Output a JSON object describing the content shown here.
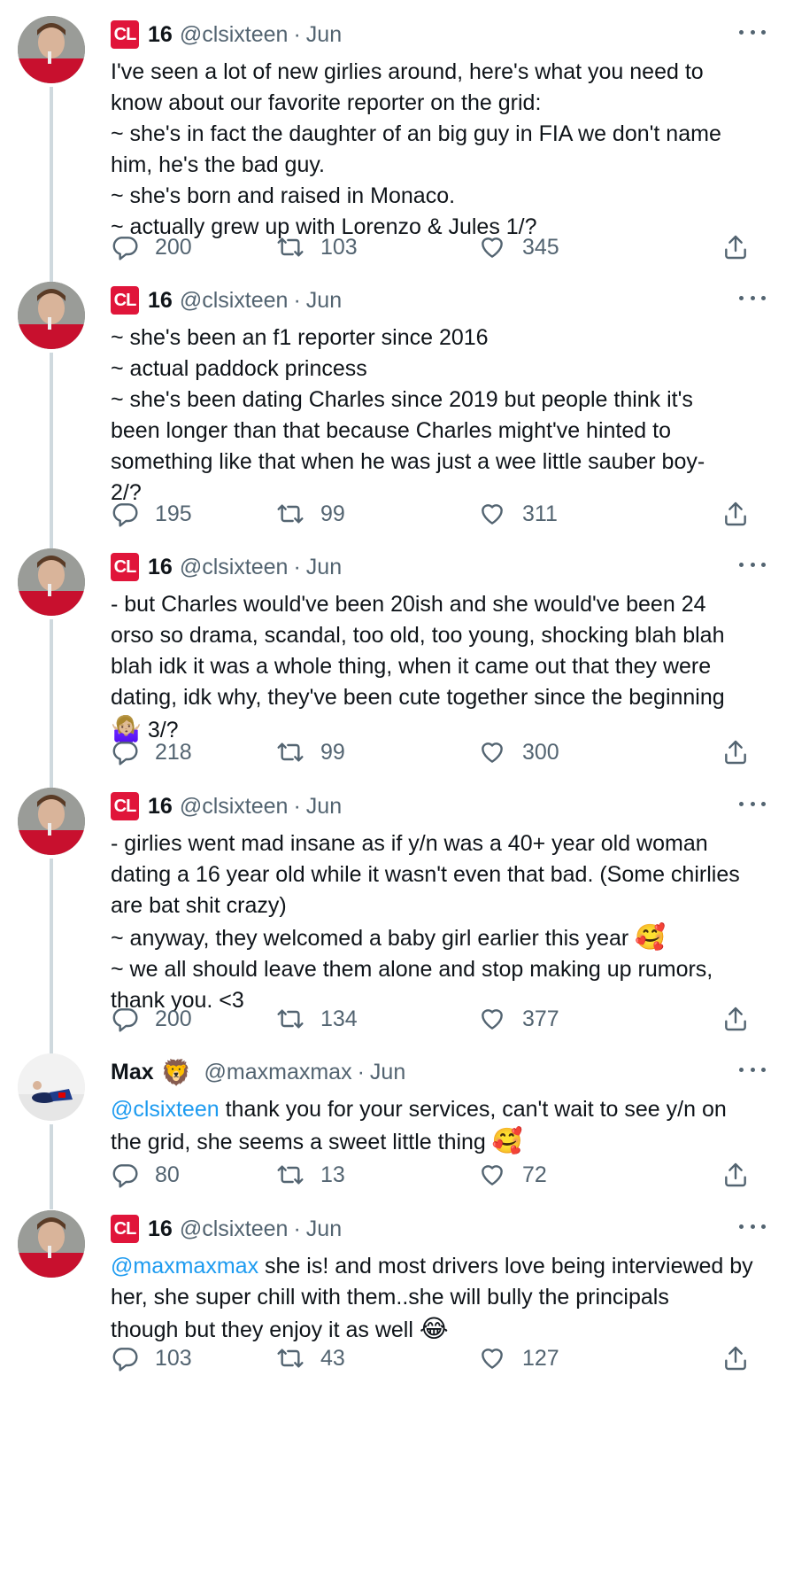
{
  "tweets": [
    {
      "name": "16",
      "handle": "@clsixteen",
      "sep": "·",
      "date": "Jun",
      "badge": "CL",
      "text": "I've seen a lot of new girlies around, here's what you need to\nknow about our favorite reporter on the grid:\n~ she's in fact the daughter of an big guy in FIA we don't name\nhim, he's the bad guy.\n~ she's born and raised in Monaco.\n~ actually grew up with Lorenzo & Jules 1/?",
      "replies": "200",
      "retweets": "103",
      "likes": "345"
    },
    {
      "name": "16",
      "handle": "@clsixteen",
      "sep": "·",
      "date": "Jun",
      "badge": "CL",
      "text": "~ she's been an f1 reporter since 2016\n~ actual paddock princess\n~ she's been dating Charles since 2019 but people think it's\nbeen longer than that because Charles might've hinted to\nsomething like that when he was just a wee little sauber boy-\n2/?",
      "replies": "195",
      "retweets": "99",
      "likes": "311"
    },
    {
      "name": "16",
      "handle": "@clsixteen",
      "sep": "·",
      "date": "Jun",
      "badge": "CL",
      "text": "- but Charles would've been 20ish and she would've been 24\norso so drama, scandal, too old, too young, shocking blah blah\nblah idk it was a whole thing, when it came out that they were\ndating, idk why, they've been cute together since the beginning",
      "text_end_emoji": "🤷🏼‍♀️",
      "text_end": " 3/?",
      "replies": "218",
      "retweets": "99",
      "likes": "300"
    },
    {
      "name": "16",
      "handle": "@clsixteen",
      "sep": "·",
      "date": "Jun",
      "badge": "CL",
      "text": "- girlies went mad insane as if y/n was a 40+ year old woman\ndating a 16 year old while it wasn't even that bad. (Some chirlies\nare bat shit crazy)\n~ anyway, they welcomed a baby girl earlier this year ",
      "text_emoji": "🥰",
      "text_end": "\n~ we all should leave them alone and stop making up rumors,\nthank you. <3",
      "replies": "200",
      "retweets": "134",
      "likes": "377"
    },
    {
      "name": "Max",
      "name_emoji": "🦁",
      "handle": "@maxmaxmax",
      "sep": "·",
      "date": "Jun",
      "mention": "@clsixteen",
      "text": " thank you for your services, can't wait to see y/n on\nthe grid, she seems a sweet little thing ",
      "text_emoji": "🥰",
      "replies": "80",
      "retweets": "13",
      "likes": "72"
    },
    {
      "name": "16",
      "handle": "@clsixteen",
      "sep": "·",
      "date": "Jun",
      "badge": "CL",
      "mention": "@maxmaxmax",
      "text": " she is! and most drivers love being interviewed by\nher, she super chill with them..she will bully the principals\nthough but they enjoy it as well ",
      "text_emoji": "😂",
      "replies": "103",
      "retweets": "43",
      "likes": "127"
    }
  ],
  "colors": {
    "badge": "#e0153a",
    "mention": "#1d9bf0",
    "meta": "#536471",
    "thread_line": "#cfd9de"
  }
}
